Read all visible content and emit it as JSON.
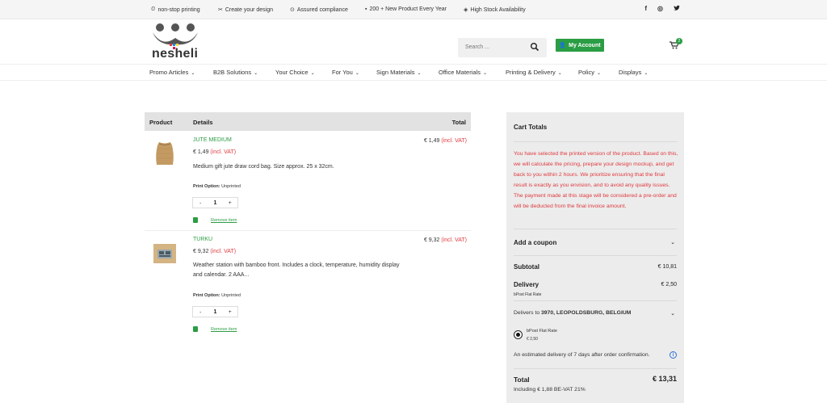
{
  "topbar": {
    "usps": [
      {
        "icon": "clock-icon",
        "label": "non-stop printing"
      },
      {
        "icon": "scissors-icon",
        "label": "Create your design"
      },
      {
        "icon": "check-circle-icon",
        "label": "Assured compliance"
      },
      {
        "icon": "bag-icon",
        "label": "200 + New Product Every Year"
      },
      {
        "icon": "box-icon",
        "label": "High Stock Availability"
      }
    ],
    "social": {
      "facebook": "f",
      "instagram": "◎",
      "twitter": "🐦"
    }
  },
  "header": {
    "logo_text": "nesheli",
    "search_placeholder": "Search ...",
    "account_label": "My Account",
    "cart_count": "2"
  },
  "nav": [
    "Promo Articles",
    "B2B Solutions",
    "Your Choice",
    "For You",
    "Sign Materials",
    "Office Materials",
    "Printing & Delivery",
    "Policy",
    "Displays"
  ],
  "cart": {
    "headers": {
      "product": "Product",
      "details": "Details",
      "total": "Total"
    },
    "items": [
      {
        "name": "JUTE MEDIUM",
        "price": "€ 1,49",
        "vat": "(incl. VAT)",
        "total": "€ 1,49",
        "description": "Medium gift jute draw cord bag. Size approx. 25 x 32cm.",
        "option_label": "Print Option:",
        "option_value": "Unprinted",
        "qty_minus": "-",
        "qty": "1",
        "qty_plus": "+",
        "remove": "Remove item"
      },
      {
        "name": "TURKU",
        "price": "€ 9,32",
        "vat": "(incl. VAT)",
        "total": "€ 9,32",
        "description": "Weather station with bamboo front. Includes a clock, temperature, humidity display and calendar. 2 AAA...",
        "option_label": "Print Option:",
        "option_value": "Unprinted",
        "qty_minus": "-",
        "qty": "1",
        "qty_plus": "+",
        "remove": "Remove item"
      }
    ]
  },
  "totals": {
    "title": "Cart Totals",
    "notice": "You have selected the printed version of the product. Based on this, we will calculate the pricing, prepare your design mockup, and get back to you within 2 hours. We prioritize ensuring that the final result is exactly as you envision, and to avoid any quality issues. The payment made at this stage will be considered a pre-order and will be deducted from the final invoice amount.",
    "coupon_label": "Add a coupon",
    "subtotal_label": "Subtotal",
    "subtotal_value": "€ 10,81",
    "delivery_label": "Delivery",
    "delivery_value": "€ 2,50",
    "delivery_method": "bPost Flat Rate",
    "delivers_to_prefix": "Delivers to",
    "delivers_to": "3970, LEOPOLDSBURG, BELGIUM",
    "option_name": "bPost Flat Rate",
    "option_price": "€ 2,50",
    "estimate": "An estimated delivery of 7 days after order confirmation.",
    "total_label": "Total",
    "total_value": "€ 13,31",
    "vat_note": "Including € 1,88 BE-VAT 21%"
  },
  "colors": {
    "accent": "#2b9d44",
    "notice": "#e0393e",
    "panel": "#ececec"
  }
}
